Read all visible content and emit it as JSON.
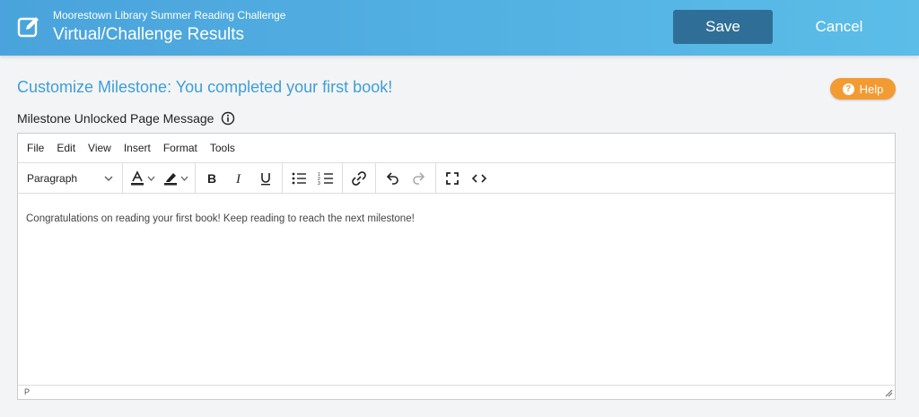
{
  "header": {
    "subtitle": "Moorestown Library Summer Reading Challenge",
    "title": "Virtual/Challenge Results",
    "save_label": "Save",
    "cancel_label": "Cancel",
    "icon": "edit-icon"
  },
  "page": {
    "title": "Customize Milestone: You completed your first book!",
    "help_label": "Help",
    "field_label": "Milestone Unlocked Page Message"
  },
  "editor": {
    "menus": [
      "File",
      "Edit",
      "View",
      "Insert",
      "Format",
      "Tools"
    ],
    "block_format": "Paragraph",
    "toolbar_icons": [
      "text-color-icon",
      "highlight-icon",
      "bold-icon",
      "italic-icon",
      "underline-icon",
      "bullet-list-icon",
      "numbered-list-icon",
      "link-icon",
      "undo-icon",
      "redo-icon",
      "fullscreen-icon",
      "source-code-icon"
    ],
    "content": "Congratulations on reading your first book! Keep reading to reach the next milestone!",
    "status_path": "P"
  },
  "colors": {
    "header_start": "#4aa3dc",
    "header_end": "#5bbde8",
    "save_button": "#2f6f97",
    "title_accent": "#3d9fd6",
    "help_button": "#f39b33"
  }
}
